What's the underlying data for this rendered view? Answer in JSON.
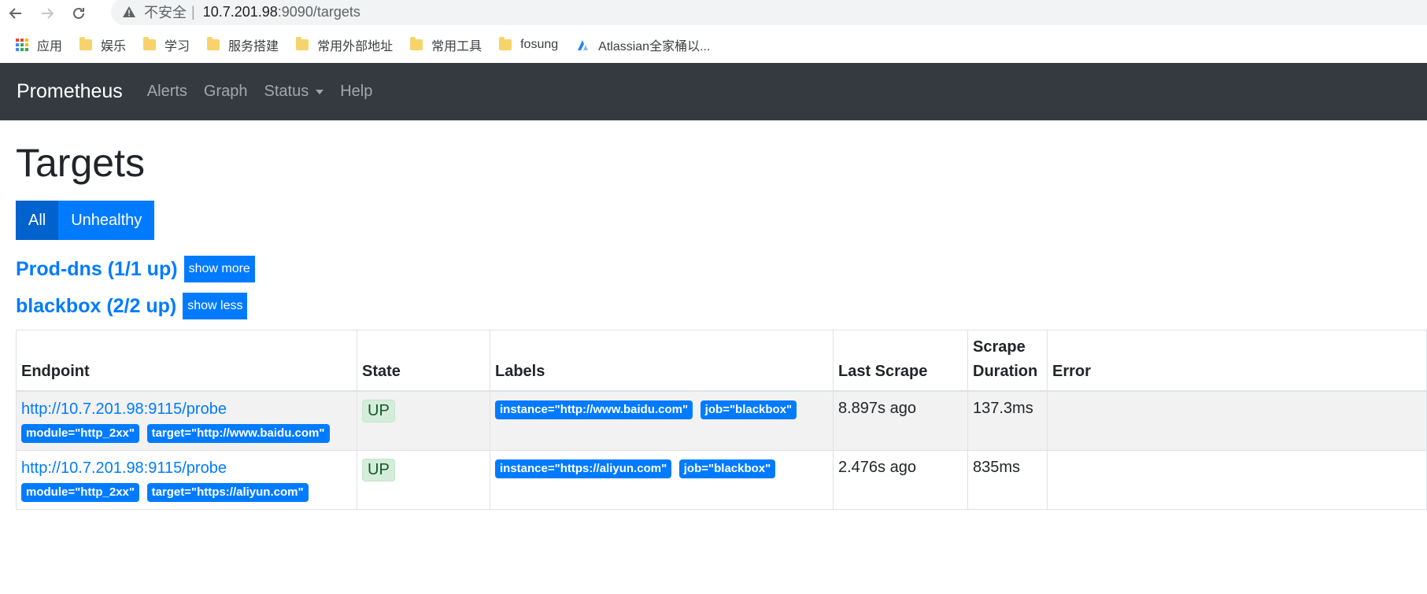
{
  "browser": {
    "insecure_label": "不安全",
    "separator": "|",
    "url_host": "10.7.201.98",
    "url_rest": ":9090/targets"
  },
  "bookmarks": [
    {
      "label": "应用",
      "icon": "apps-grid-icon"
    },
    {
      "label": "娱乐",
      "icon": "folder-icon"
    },
    {
      "label": "学习",
      "icon": "folder-icon"
    },
    {
      "label": "服务搭建",
      "icon": "folder-icon"
    },
    {
      "label": "常用外部地址",
      "icon": "folder-icon"
    },
    {
      "label": "常用工具",
      "icon": "folder-icon"
    },
    {
      "label": "fosung",
      "icon": "folder-icon"
    },
    {
      "label": "Atlassian全家桶以...",
      "icon": "atlassian-icon"
    }
  ],
  "nav": {
    "brand": "Prometheus",
    "links": [
      "Alerts",
      "Graph",
      "Status",
      "Help"
    ]
  },
  "page": {
    "title": "Targets",
    "filter_all": "All",
    "filter_unhealthy": "Unhealthy"
  },
  "pools": [
    {
      "title": "Prod-dns (1/1 up)",
      "toggle": "show more"
    },
    {
      "title": "blackbox (2/2 up)",
      "toggle": "show less"
    }
  ],
  "table": {
    "headers": [
      "Endpoint",
      "State",
      "Labels",
      "Last Scrape",
      "Scrape Duration",
      "Error"
    ],
    "rows": [
      {
        "endpoint": "http://10.7.201.98:9115/probe",
        "params": [
          "module=\"http_2xx\"",
          "target=\"http://www.baidu.com\""
        ],
        "state": "UP",
        "labels": [
          "instance=\"http://www.baidu.com\"",
          "job=\"blackbox\""
        ],
        "last_scrape": "8.897s ago",
        "duration": "137.3ms",
        "error": ""
      },
      {
        "endpoint": "http://10.7.201.98:9115/probe",
        "params": [
          "module=\"http_2xx\"",
          "target=\"https://aliyun.com\""
        ],
        "state": "UP",
        "labels": [
          "instance=\"https://aliyun.com\"",
          "job=\"blackbox\""
        ],
        "last_scrape": "2.476s ago",
        "duration": "835ms",
        "error": ""
      }
    ]
  },
  "colors": {
    "navbar": "#343a40",
    "primary": "#007bff",
    "primary_active": "#0062cc",
    "up_bg": "#d4edda",
    "up_text": "#155724"
  }
}
